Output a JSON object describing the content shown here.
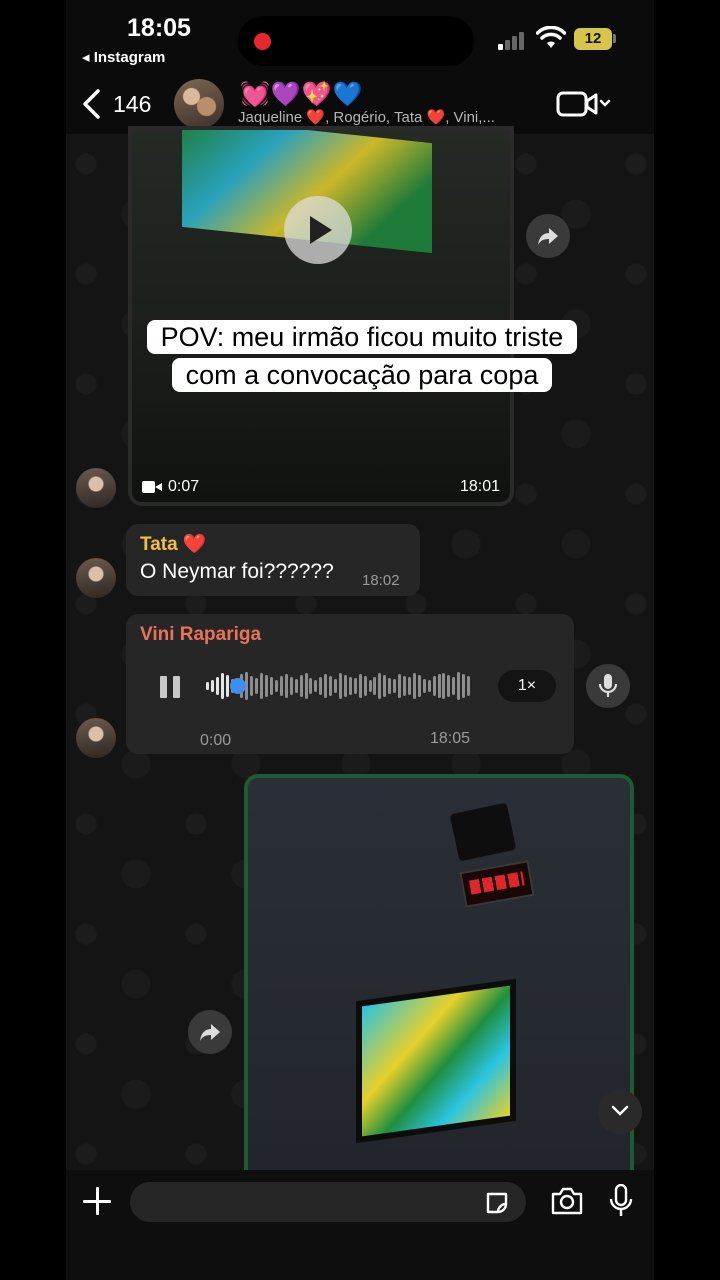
{
  "status_bar": {
    "time": "18:05",
    "back_app": "◂ Instagram",
    "battery": "12"
  },
  "header": {
    "unread_count": "146",
    "group_emojis": "💓💜💖💙",
    "members": "Jaqueline ❤️, Rogério, Tata ❤️, Vini,..."
  },
  "caption": {
    "line1": "POV: meu irmão ficou muito triste",
    "line2": "com a convocação para copa"
  },
  "video_message": {
    "duration": "0:07",
    "time": "18:01"
  },
  "text_message": {
    "sender": "Tata ❤️",
    "sender_color": "#f0c040",
    "text": "O Neymar foi??????",
    "time": "18:02"
  },
  "voice_message": {
    "sender": "Vini Rapariga",
    "sender_color": "#e8735a",
    "elapsed": "0:00",
    "speed": "1×",
    "time": "18:05",
    "progress": 0.04
  },
  "input_bar": {
    "placeholder": ""
  },
  "colors": {
    "accent_blue": "#3d8ef0",
    "image_border": "#1e5a34"
  }
}
